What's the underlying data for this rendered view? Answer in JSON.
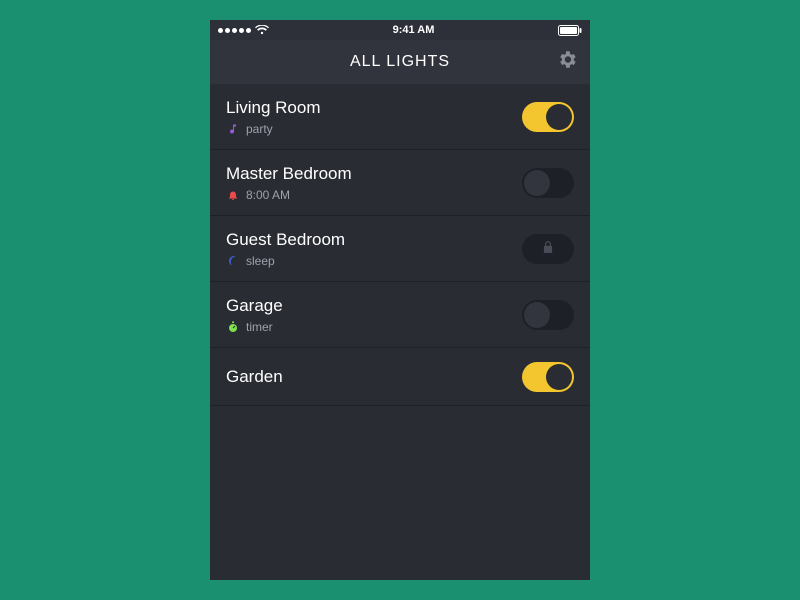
{
  "status": {
    "time": "9:41 AM"
  },
  "nav": {
    "title": "ALL LIGHTS"
  },
  "rooms": [
    {
      "name": "Living Room",
      "icon": "music",
      "icon_color": "#9b59e0",
      "sub": "party",
      "control": "toggle",
      "on": true
    },
    {
      "name": "Master Bedroom",
      "icon": "bell",
      "icon_color": "#e94b4b",
      "sub": "8:00 AM",
      "control": "toggle",
      "on": false
    },
    {
      "name": "Guest Bedroom",
      "icon": "moon",
      "icon_color": "#3a63d6",
      "sub": "sleep",
      "control": "lock"
    },
    {
      "name": "Garage",
      "icon": "stopwatch",
      "icon_color": "#7fe04a",
      "sub": "timer",
      "control": "toggle",
      "on": false
    },
    {
      "name": "Garden",
      "icon": "",
      "icon_color": "",
      "sub": "",
      "control": "toggle",
      "on": true
    }
  ]
}
